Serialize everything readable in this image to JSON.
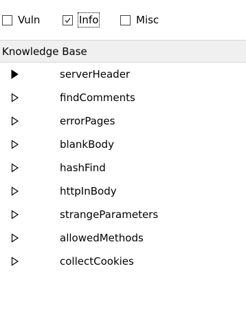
{
  "filters": {
    "vuln": {
      "label": "Vuln",
      "checked": false
    },
    "info": {
      "label": "Info",
      "checked": true
    },
    "misc": {
      "label": "Misc",
      "checked": false
    }
  },
  "header": {
    "title": "Knowledge Base"
  },
  "tree": {
    "items": [
      {
        "label": "serverHeader",
        "expander": "filled-triangle-icon"
      },
      {
        "label": "findComments",
        "expander": "outline-triangle-icon"
      },
      {
        "label": "errorPages",
        "expander": "outline-triangle-icon"
      },
      {
        "label": "blankBody",
        "expander": "outline-triangle-icon"
      },
      {
        "label": "hashFind",
        "expander": "outline-triangle-icon"
      },
      {
        "label": "httpInBody",
        "expander": "outline-triangle-icon"
      },
      {
        "label": "strangeParameters",
        "expander": "outline-triangle-icon"
      },
      {
        "label": "allowedMethods",
        "expander": "outline-triangle-icon"
      },
      {
        "label": "collectCookies",
        "expander": "outline-triangle-icon"
      }
    ]
  }
}
